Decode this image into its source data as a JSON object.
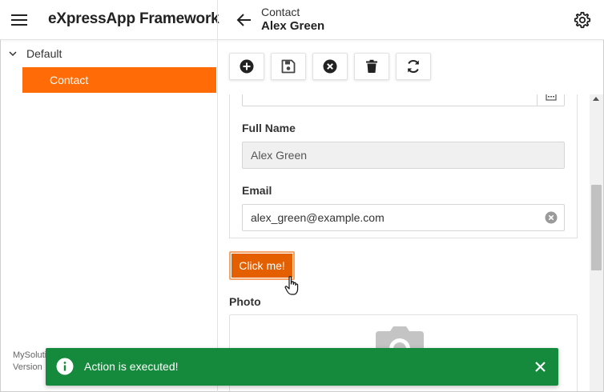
{
  "header": {
    "app_title": "eXpressApp Framework",
    "view_caption": "Contact",
    "view_title": "Alex Green"
  },
  "sidebar": {
    "group_label": "Default",
    "items": [
      {
        "label": "Contact",
        "selected": true
      }
    ],
    "solution_name": "MySolution",
    "version_label": "Version"
  },
  "toolbar": {
    "buttons": [
      {
        "name": "new",
        "icon": "plus-circle-icon"
      },
      {
        "name": "save",
        "icon": "save-icon"
      },
      {
        "name": "cancel",
        "icon": "close-circle-icon"
      },
      {
        "name": "delete",
        "icon": "trash-icon"
      },
      {
        "name": "refresh",
        "icon": "refresh-icon"
      }
    ]
  },
  "form": {
    "full_name_label": "Full Name",
    "full_name_value": "Alex Green",
    "email_label": "Email",
    "email_value": "alex_green@example.com",
    "action_button_label": "Click me!",
    "photo_label": "Photo"
  },
  "toast": {
    "message": "Action is executed!"
  },
  "colors": {
    "accent": "#ff6c07",
    "action_button": "#e35f00",
    "toast_success": "#15893c"
  }
}
